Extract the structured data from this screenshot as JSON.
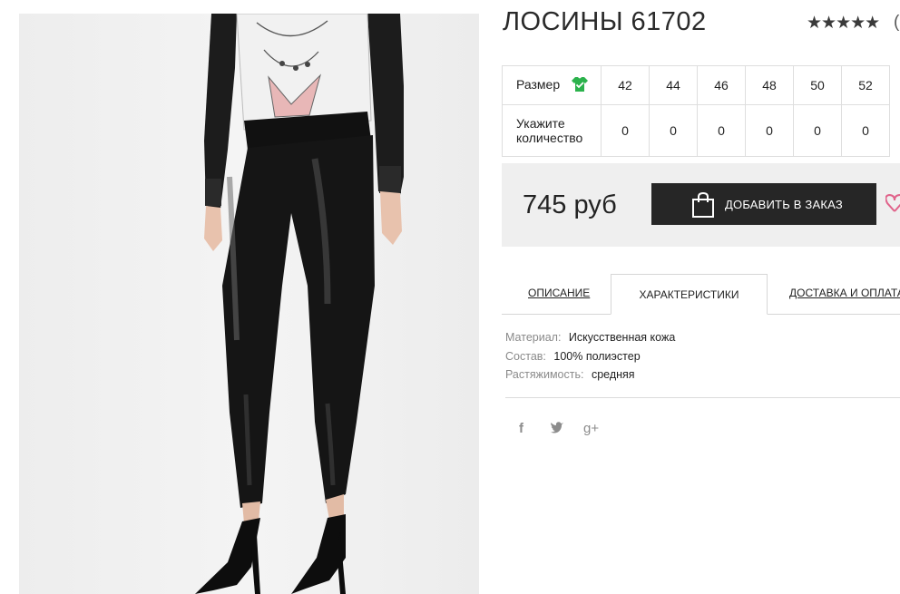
{
  "product": {
    "title": "ЛОСИНЫ 61702",
    "rating_stars": "★★★★★",
    "rating_extra": "("
  },
  "sizes": {
    "size_label": "Размер",
    "qty_label_line1": "Укажите",
    "qty_label_line2": "количество",
    "values": [
      "42",
      "44",
      "46",
      "48",
      "50",
      "52"
    ],
    "quantities": [
      "0",
      "0",
      "0",
      "0",
      "0",
      "0"
    ]
  },
  "buy": {
    "price": "745 руб",
    "add_label": "ДОБАВИТЬ В ЗАКАЗ"
  },
  "tabs": {
    "description": "ОПИСАНИЕ",
    "characteristics": "ХАРАКТЕРИСТИКИ",
    "delivery": "ДОСТАВКА И ОПЛАТА"
  },
  "props": [
    {
      "key": "Материал:",
      "value": "Искусственная кожа"
    },
    {
      "key": "Состав:",
      "value": "100% полиэстер"
    },
    {
      "key": "Растяжимость:",
      "value": "средняя"
    }
  ],
  "social": {
    "facebook": "f",
    "twitter": "t",
    "google": "g+"
  },
  "icons": {
    "size_chart": "shirt-check-icon",
    "cart": "shopping-bag-icon",
    "wishlist": "heart-icon",
    "facebook": "facebook-icon",
    "twitter": "twitter-icon",
    "google": "google-plus-icon"
  },
  "colors": {
    "button_bg": "#262626",
    "buybox_bg": "#efefef",
    "size_icon": "#2bb24c",
    "wishlist": "#e0628a"
  }
}
